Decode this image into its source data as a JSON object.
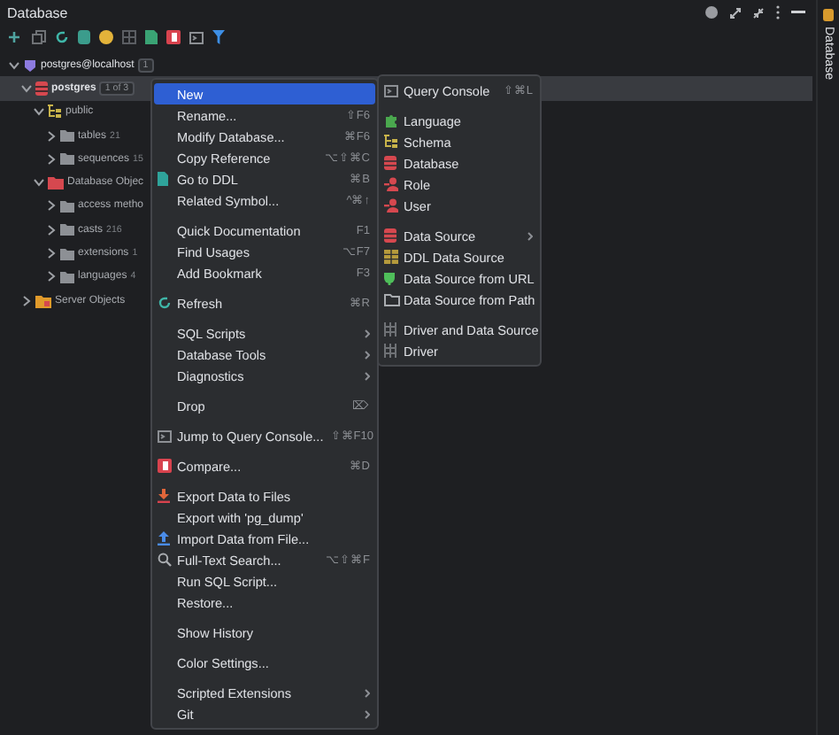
{
  "window": {
    "title": "Database"
  },
  "side_strip": {
    "label": "Database"
  },
  "tree": [
    {
      "kind": "host",
      "label": "postgres@localhost",
      "badge": "1",
      "badge_boxed": true,
      "expanded": true,
      "selected": false,
      "children": [
        {
          "kind": "database",
          "label": "postgres",
          "badge": "1 of 3",
          "badge_boxed": true,
          "expanded": true,
          "selected": true,
          "children": [
            {
              "kind": "schema",
              "label": "public",
              "expanded": true,
              "selected": false,
              "children": [
                {
                  "kind": "folder",
                  "label": "tables",
                  "badge": "21",
                  "expanded": false,
                  "selected": false
                },
                {
                  "kind": "folder",
                  "label": "sequences",
                  "badge": "15",
                  "expanded": false,
                  "selected": false
                }
              ]
            },
            {
              "kind": "objects",
              "label": "Database Objec",
              "expanded": true,
              "selected": false,
              "children": [
                {
                  "kind": "folder",
                  "label": "access metho",
                  "expanded": false,
                  "selected": false
                },
                {
                  "kind": "folder",
                  "label": "casts",
                  "badge": "216",
                  "expanded": false,
                  "selected": false
                },
                {
                  "kind": "folder",
                  "label": "extensions",
                  "badge": "1",
                  "expanded": false,
                  "selected": false
                },
                {
                  "kind": "folder",
                  "label": "languages",
                  "badge": "4",
                  "expanded": false,
                  "selected": false
                }
              ]
            }
          ]
        },
        {
          "kind": "server",
          "label": "Server Objects",
          "expanded": false,
          "selected": false
        }
      ]
    }
  ],
  "context_menu": [
    [
      {
        "label": "New",
        "selected": true
      },
      {
        "label": "Rename...",
        "shortcut": "⇧F6",
        "selected": false
      },
      {
        "label": "Modify Database...",
        "shortcut": "⌘F6",
        "selected": false
      },
      {
        "label": "Copy Reference",
        "shortcut": "⌥⇧⌘C",
        "selected": false
      },
      {
        "label": "Go to DDL",
        "shortcut": "⌘B",
        "selected": false
      },
      {
        "label": "Related Symbol...",
        "shortcut": "^⌘↑",
        "selected": false
      }
    ],
    [
      {
        "label": "Quick Documentation",
        "shortcut": "F1",
        "selected": false
      },
      {
        "label": "Find Usages",
        "shortcut": "⌥F7",
        "selected": false
      },
      {
        "label": "Add Bookmark",
        "shortcut": "F3",
        "selected": false
      }
    ],
    [
      {
        "label": "Refresh",
        "shortcut": "⌘R",
        "selected": false
      }
    ],
    [
      {
        "label": "SQL Scripts",
        "submenu": true,
        "selected": false
      },
      {
        "label": "Database Tools",
        "submenu": true,
        "selected": false
      },
      {
        "label": "Diagnostics",
        "submenu": true,
        "selected": false
      }
    ],
    [
      {
        "label": "Drop",
        "shortcut": "⌦",
        "selected": false
      }
    ],
    [
      {
        "label": "Jump to Query Console...",
        "shortcut": "⇧⌘F10",
        "selected": false
      }
    ],
    [
      {
        "label": "Compare...",
        "shortcut": "⌘D",
        "selected": false
      }
    ],
    [
      {
        "label": "Export Data to Files",
        "selected": false
      },
      {
        "label": "Export with 'pg_dump'",
        "selected": false
      },
      {
        "label": "Import Data from File...",
        "selected": false
      },
      {
        "label": "Full-Text Search...",
        "shortcut": "⌥⇧⌘F",
        "selected": false
      },
      {
        "label": "Run SQL Script...",
        "selected": false
      },
      {
        "label": "Restore...",
        "selected": false
      }
    ],
    [
      {
        "label": "Show History",
        "selected": false
      }
    ],
    [
      {
        "label": "Color Settings...",
        "selected": false
      }
    ],
    [
      {
        "label": "Scripted Extensions",
        "submenu": true,
        "selected": false
      },
      {
        "label": "Git",
        "submenu": true,
        "selected": false
      }
    ]
  ],
  "new_submenu": [
    [
      {
        "label": "Query Console",
        "shortcut": "⇧⌘L",
        "selected": false
      }
    ],
    [
      {
        "label": "Language",
        "selected": false
      },
      {
        "label": "Schema",
        "selected": false
      },
      {
        "label": "Database",
        "selected": false
      },
      {
        "label": "Role",
        "selected": false
      },
      {
        "label": "User",
        "selected": false
      }
    ],
    [
      {
        "label": "Data Source",
        "submenu": true,
        "selected": false
      },
      {
        "label": "DDL Data Source",
        "selected": false
      },
      {
        "label": "Data Source from URL",
        "selected": false
      },
      {
        "label": "Data Source from Path",
        "selected": false
      }
    ],
    [
      {
        "label": "Driver and Data Source",
        "selected": false
      },
      {
        "label": "Driver",
        "selected": false
      }
    ]
  ]
}
